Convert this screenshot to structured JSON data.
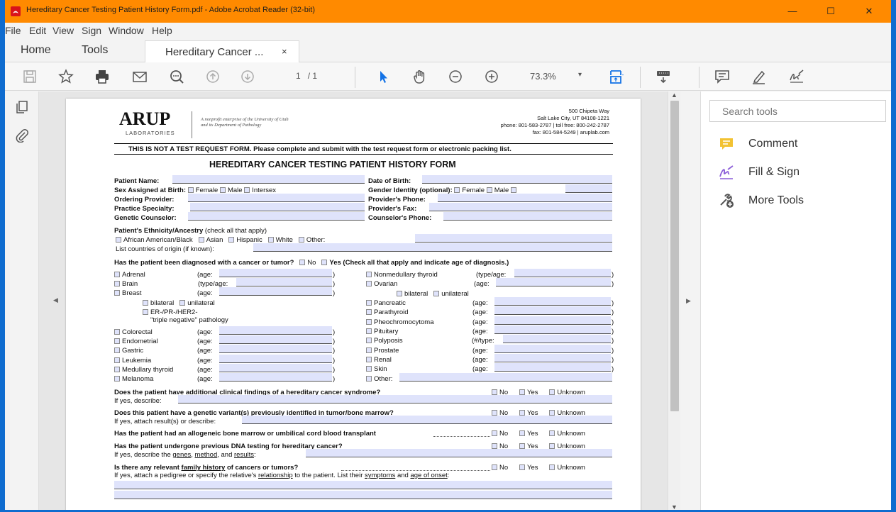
{
  "window": {
    "title": "Hereditary Cancer Testing Patient History Form.pdf - Adobe Acrobat Reader (32-bit)",
    "min": "—",
    "max": "☐",
    "close": "✕"
  },
  "menu": [
    "File",
    "Edit",
    "View",
    "Sign",
    "Window",
    "Help"
  ],
  "tabs": {
    "home": "Home",
    "tools": "Tools",
    "doc": "Hereditary Cancer ...",
    "close": "×"
  },
  "toolbar": {
    "page_current": "1",
    "page_total": "/ 1",
    "zoom": "73.3%",
    "zoom_arrow": "▾"
  },
  "right": {
    "search_placeholder": "Search tools",
    "tools": [
      {
        "label": "Comment",
        "icon": "comment-icon",
        "color": "#f2c232"
      },
      {
        "label": "Fill & Sign",
        "icon": "fill-sign-icon",
        "color": "#8a5cd8"
      },
      {
        "label": "More Tools",
        "icon": "more-tools-icon",
        "color": "#555555"
      }
    ]
  },
  "pdf": {
    "logo": "ARUP",
    "logo_sub": "LABORATORIES",
    "tagline1": "A nonprofit enterprise of the University of Utah",
    "tagline2": "and its Department of Pathology",
    "addr": [
      "500 Chipeta Way",
      "Salt Lake City, UT 84108-1221",
      "phone: 801-583-2787 | toll free: 800-242-2787",
      "fax: 801-584-5249 | aruplab.com"
    ],
    "notice": "THIS IS NOT A TEST REQUEST FORM. Please complete and submit with the test request form or electronic packing list.",
    "heading": "HEREDITARY CANCER TESTING PATIENT HISTORY FORM",
    "patient_name": "Patient Name:",
    "dob": "Date of Birth:",
    "sex": "Sex Assigned at Birth:",
    "female": "Female",
    "male": "Male",
    "intersex": "Intersex",
    "gender": "Gender Identity (optional):",
    "ordering": "Ordering Provider:",
    "prov_phone": "Provider's Phone:",
    "specialty": "Practice Specialty:",
    "prov_fax": "Provider's Fax:",
    "counselor": "Genetic Counselor:",
    "couns_phone": "Counselor's Phone:",
    "eth_head": "Patient's Ethnicity/Ancestry",
    "eth_note": "(check all that apply)",
    "eth": [
      "African American/Black",
      "Asian",
      "Hispanic",
      "White",
      "Other:"
    ],
    "countries": "List countries of origin (if known):",
    "diag_q": "Has the patient been diagnosed with a cancer or tumor?",
    "no": "No",
    "yes": "Yes",
    "yes_note": "(Check all that apply and indicate age of diagnosis.)",
    "unknown": "Unknown",
    "age": "(age:",
    "typeage": "(type/age:",
    "numtype": "(#/type:",
    "close_paren": ")",
    "left_cancers": [
      "Adrenal",
      "Brain",
      "Breast"
    ],
    "bilateral": "bilateral",
    "unilateral": "unilateral",
    "er": "ER-/PR-/HER2-",
    "tn": "\"triple negative\" pathology",
    "left_cancers2": [
      "Colorectal",
      "Endometrial",
      "Gastric",
      "Leukemia",
      "Medullary thyroid",
      "Melanoma"
    ],
    "right_cancers": [
      "Nonmedullary thyroid",
      "Ovarian"
    ],
    "right_cancers2": [
      "Pancreatic",
      "Parathyroid",
      "Pheochromocytoma",
      "Pituitary",
      "Polyposis",
      "Prostate",
      "Renal",
      "Skin"
    ],
    "other": "Other:",
    "q1": "Does the patient have additional clinical findings of a hereditary cancer syndrome?",
    "q1b": "If yes, describe:",
    "q2": "Does this patient have a genetic variant(s) previously identified in tumor/bone marrow?",
    "q2b": "If yes, attach result(s) or describe:",
    "q3": "Has the patient had an allogeneic bone marrow or umbilical cord blood transplant",
    "q4": "Has the patient undergone previous DNA testing for hereditary cancer?",
    "q4b1": "If yes, describe the ",
    "q4b_genes": "genes",
    "q4b_comma": ", ",
    "q4b_method": "method",
    "q4b_and": ", and ",
    "q4b_results": "results",
    "q4b_colon": ":",
    "q5a": "Is there any relevant ",
    "q5_fh": "family history",
    "q5b": " of cancers or tumors?",
    "q6a": "If yes, attach a pedigree or specify the relative's ",
    "q6_rel": "relationship",
    "q6b": " to the patient. List their ",
    "q6_sym": "symptoms",
    "q6c": " and ",
    "q6_age": "age of onset",
    "q6d": ":"
  }
}
